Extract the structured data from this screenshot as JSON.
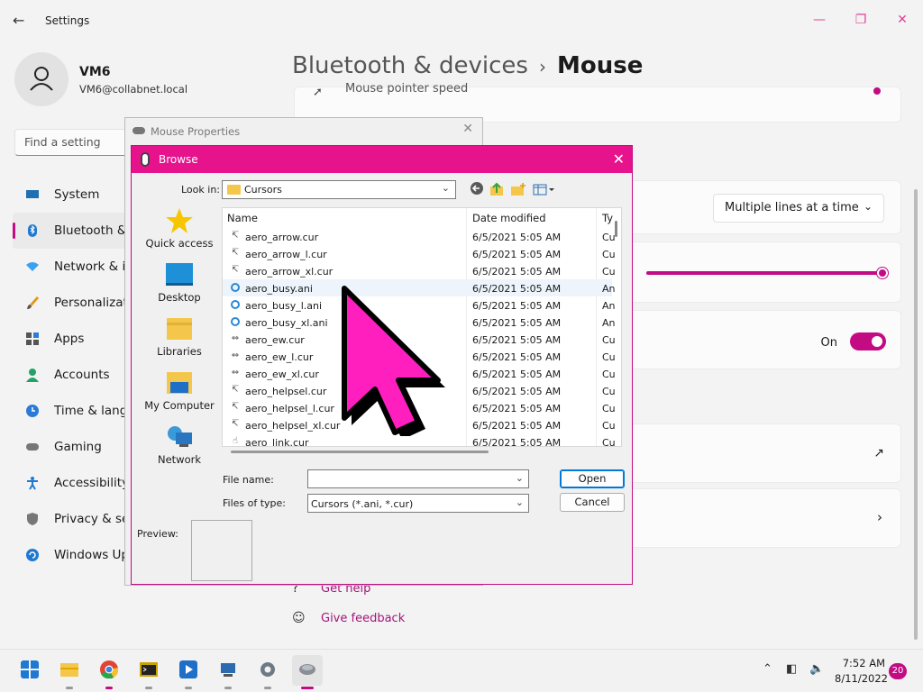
{
  "settings": {
    "app_title": "Settings",
    "user": {
      "name": "VM6",
      "email": "VM6@collabnet.local"
    },
    "search_placeholder": "Find a setting",
    "nav": [
      {
        "label": "System",
        "icon": "monitor-icon"
      },
      {
        "label": "Bluetooth & devices",
        "icon": "bluetooth-icon"
      },
      {
        "label": "Network & internet",
        "icon": "wifi-icon"
      },
      {
        "label": "Personalization",
        "icon": "brush-icon"
      },
      {
        "label": "Apps",
        "icon": "apps-icon"
      },
      {
        "label": "Accounts",
        "icon": "person-icon"
      },
      {
        "label": "Time & language",
        "icon": "clock-globe-icon"
      },
      {
        "label": "Gaming",
        "icon": "gamepad-icon"
      },
      {
        "label": "Accessibility",
        "icon": "accessibility-icon"
      },
      {
        "label": "Privacy & security",
        "icon": "shield-icon"
      },
      {
        "label": "Windows Update",
        "icon": "update-icon"
      }
    ],
    "breadcrumb": {
      "parent": "Bluetooth & devices",
      "separator": "›",
      "current": "Mouse"
    },
    "pointer_speed_label": "Mouse pointer speed",
    "scroll_dropdown_value": "Multiple lines at a time",
    "scroll_inactive_toggle": {
      "label": "On",
      "state": true
    },
    "scroll_speed_level": 1.0,
    "footer": {
      "get_help": "Get help",
      "give_feedback": "Give feedback"
    }
  },
  "mouse_properties": {
    "title": "Mouse Properties"
  },
  "browse": {
    "title": "Browse",
    "look_in_label": "Look in:",
    "look_in_value": "Cursors",
    "places": [
      "Quick access",
      "Desktop",
      "Libraries",
      "My Computer",
      "Network"
    ],
    "columns": {
      "name": "Name",
      "date": "Date modified",
      "type": "Ty"
    },
    "files": [
      {
        "name": "aero_arrow.cur",
        "date": "6/5/2021 5:05 AM",
        "type": "Cu",
        "icon": "arrow-cursor-icon"
      },
      {
        "name": "aero_arrow_l.cur",
        "date": "6/5/2021 5:05 AM",
        "type": "Cu",
        "icon": "arrow-cursor-icon"
      },
      {
        "name": "aero_arrow_xl.cur",
        "date": "6/5/2021 5:05 AM",
        "type": "Cu",
        "icon": "arrow-cursor-icon"
      },
      {
        "name": "aero_busy.ani",
        "date": "6/5/2021 5:05 AM",
        "type": "An",
        "icon": "busy-ring-icon",
        "selected": true
      },
      {
        "name": "aero_busy_l.ani",
        "date": "6/5/2021 5:05 AM",
        "type": "An",
        "icon": "busy-ring-icon"
      },
      {
        "name": "aero_busy_xl.ani",
        "date": "6/5/2021 5:05 AM",
        "type": "An",
        "icon": "busy-ring-icon"
      },
      {
        "name": "aero_ew.cur",
        "date": "6/5/2021 5:05 AM",
        "type": "Cu",
        "icon": "resize-ew-icon"
      },
      {
        "name": "aero_ew_l.cur",
        "date": "6/5/2021 5:05 AM",
        "type": "Cu",
        "icon": "resize-ew-icon"
      },
      {
        "name": "aero_ew_xl.cur",
        "date": "6/5/2021 5:05 AM",
        "type": "Cu",
        "icon": "resize-ew-icon"
      },
      {
        "name": "aero_helpsel.cur",
        "date": "6/5/2021 5:05 AM",
        "type": "Cu",
        "icon": "help-cursor-icon"
      },
      {
        "name": "aero_helpsel_l.cur",
        "date": "6/5/2021 5:05 AM",
        "type": "Cu",
        "icon": "help-cursor-icon"
      },
      {
        "name": "aero_helpsel_xl.cur",
        "date": "6/5/2021 5:05 AM",
        "type": "Cu",
        "icon": "help-cursor-icon"
      },
      {
        "name": "aero_link.cur",
        "date": "6/5/2021 5:05 AM",
        "type": "Cu",
        "icon": "hand-cursor-icon"
      }
    ],
    "file_name_label": "File name:",
    "file_name_value": "",
    "file_type_label": "Files of type:",
    "file_type_value": "Cursors (*.ani, *.cur)",
    "open_label": "Open",
    "cancel_label": "Cancel",
    "preview_label": "Preview:"
  },
  "taskbar": {
    "apps": [
      "start-icon",
      "file-explorer-icon",
      "chrome-icon",
      "terminal-icon",
      "media-player-icon",
      "remote-desktop-icon",
      "settings-gear-icon",
      "mouse-properties-icon"
    ],
    "time": "7:52 AM",
    "date": "8/11/2022",
    "notification_count": "20"
  },
  "colors": {
    "accent": "#c30b84",
    "dialog_title": "#e6138c",
    "big_cursor": "#ff1fbf"
  }
}
